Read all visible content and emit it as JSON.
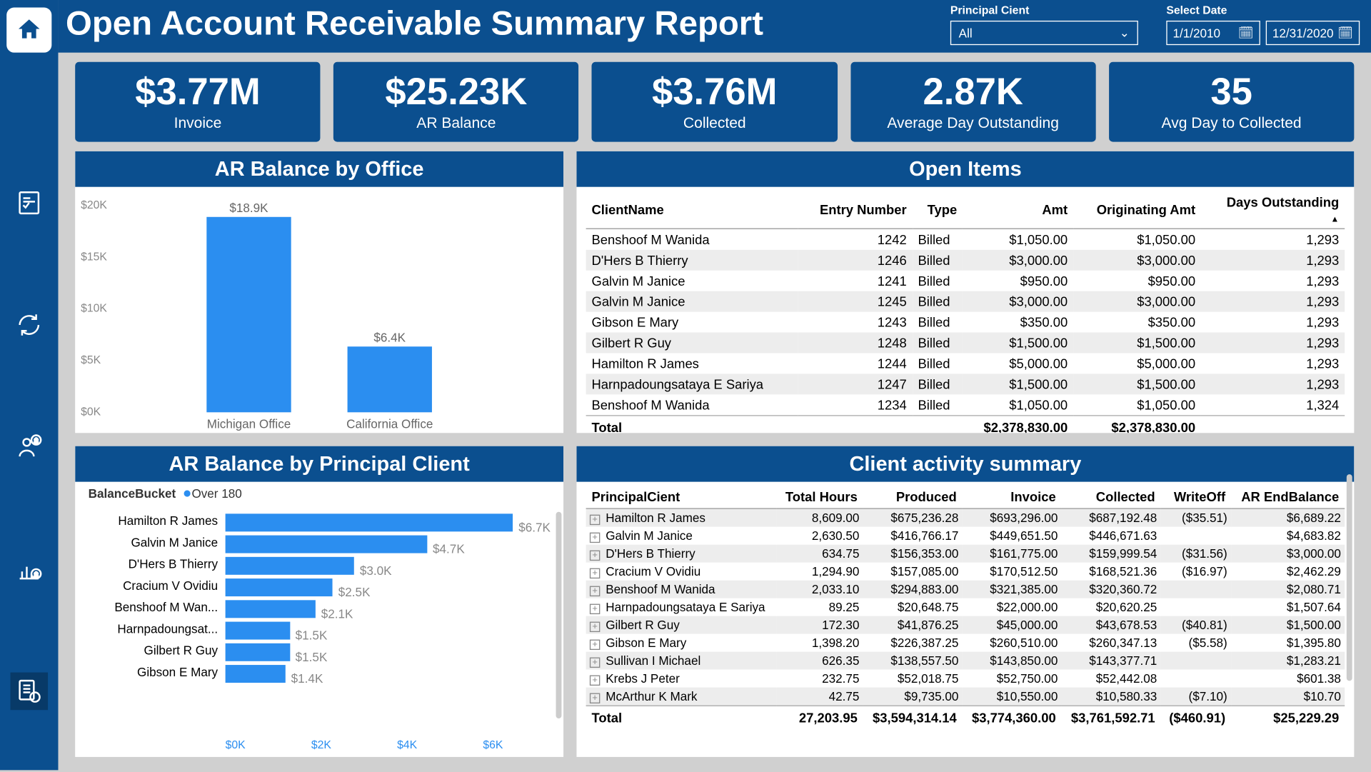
{
  "title": "Open Account Receivable Summary Report",
  "filters": {
    "client_label": "Principal Cient",
    "client_value": "All",
    "date_label": "Select Date",
    "date_start": "1/1/2010",
    "date_end": "12/31/2020"
  },
  "kpis": [
    {
      "value": "$3.77M",
      "label": "Invoice"
    },
    {
      "value": "$25.23K",
      "label": "AR Balance"
    },
    {
      "value": "$3.76M",
      "label": "Collected"
    },
    {
      "value": "2.87K",
      "label": "Average Day Outstanding"
    },
    {
      "value": "35",
      "label": "Avg Day to Collected"
    }
  ],
  "ar_office": {
    "title": "AR Balance by Office"
  },
  "ar_client": {
    "title": "AR Balance by Principal Client",
    "legend_label": "BalanceBucket",
    "legend_series": "Over 180"
  },
  "open_items": {
    "title": "Open Items",
    "headers": [
      "ClientName",
      "Entry Number",
      "Type",
      "Amt",
      "Originating Amt",
      "Days Outstanding"
    ],
    "rows": [
      [
        "Benshoof M Wanida",
        "1242",
        "Billed",
        "$1,050.00",
        "$1,050.00",
        "1,293"
      ],
      [
        "D'Hers B Thierry",
        "1246",
        "Billed",
        "$3,000.00",
        "$3,000.00",
        "1,293"
      ],
      [
        "Galvin M Janice",
        "1241",
        "Billed",
        "$950.00",
        "$950.00",
        "1,293"
      ],
      [
        "Galvin M Janice",
        "1245",
        "Billed",
        "$3,000.00",
        "$3,000.00",
        "1,293"
      ],
      [
        "Gibson E Mary",
        "1243",
        "Billed",
        "$350.00",
        "$350.00",
        "1,293"
      ],
      [
        "Gilbert R Guy",
        "1248",
        "Billed",
        "$1,500.00",
        "$1,500.00",
        "1,293"
      ],
      [
        "Hamilton R James",
        "1244",
        "Billed",
        "$5,000.00",
        "$5,000.00",
        "1,293"
      ],
      [
        "Harnpadoungsataya E Sariya",
        "1247",
        "Billed",
        "$1,500.00",
        "$1,500.00",
        "1,293"
      ],
      [
        "Benshoof M Wanida",
        "1234",
        "Billed",
        "$1,050.00",
        "$1,050.00",
        "1,324"
      ]
    ],
    "total": [
      "Total",
      "",
      "",
      "$2,378,830.00",
      "$2,378,830.00",
      ""
    ]
  },
  "activity": {
    "title": "Client activity summary",
    "headers": [
      "PrincipalCient",
      "Total Hours",
      "Produced",
      "Invoice",
      "Collected",
      "WriteOff",
      "AR EndBalance"
    ],
    "rows": [
      [
        "Hamilton R James",
        "8,609.00",
        "$675,236.28",
        "$693,296.00",
        "$687,192.48",
        "($35.51)",
        "$6,689.22"
      ],
      [
        "Galvin M Janice",
        "2,630.50",
        "$416,766.17",
        "$449,651.50",
        "$446,671.63",
        "",
        "$4,683.82"
      ],
      [
        "D'Hers B Thierry",
        "634.75",
        "$156,353.00",
        "$161,775.00",
        "$159,999.54",
        "($31.56)",
        "$3,000.00"
      ],
      [
        "Cracium V Ovidiu",
        "1,294.90",
        "$157,085.00",
        "$170,512.50",
        "$168,521.36",
        "($16.97)",
        "$2,462.29"
      ],
      [
        "Benshoof M Wanida",
        "2,033.10",
        "$294,883.00",
        "$321,385.00",
        "$320,360.72",
        "",
        "$2,080.71"
      ],
      [
        "Harnpadoungsataya E Sariya",
        "89.25",
        "$20,648.75",
        "$22,000.00",
        "$20,620.25",
        "",
        "$1,507.64"
      ],
      [
        "Gilbert R Guy",
        "172.30",
        "$41,876.25",
        "$45,000.00",
        "$43,678.53",
        "($40.81)",
        "$1,500.00"
      ],
      [
        "Gibson E Mary",
        "1,398.20",
        "$226,387.25",
        "$260,510.00",
        "$260,347.13",
        "($5.58)",
        "$1,395.80"
      ],
      [
        "Sullivan I Michael",
        "626.35",
        "$138,557.50",
        "$143,850.00",
        "$143,377.71",
        "",
        "$1,283.21"
      ],
      [
        "Krebs J Peter",
        "232.75",
        "$52,018.75",
        "$52,750.00",
        "$52,442.08",
        "",
        "$601.38"
      ],
      [
        "McArthur K Mark",
        "42.75",
        "$9,735.00",
        "$10,550.00",
        "$10,580.33",
        "($7.10)",
        "$10.70"
      ]
    ],
    "total": [
      "Total",
      "27,203.95",
      "$3,594,314.14",
      "$3,774,360.00",
      "$3,761,592.71",
      "($460.91)",
      "$25,229.29"
    ]
  },
  "chart_data": [
    {
      "type": "bar",
      "title": "AR Balance by Office",
      "categories": [
        "Michigan Office",
        "California Office"
      ],
      "values": [
        18900,
        6400
      ],
      "value_labels": [
        "$18.9K",
        "$6.4K"
      ],
      "ylabel": "",
      "xlabel": "",
      "yticks": [
        "$0K",
        "$5K",
        "$10K",
        "$15K",
        "$20K"
      ],
      "ylim": [
        0,
        20000
      ]
    },
    {
      "type": "bar",
      "orientation": "horizontal",
      "title": "AR Balance by Principal Client",
      "legend": "BalanceBucket",
      "series": [
        {
          "name": "Over 180",
          "values": [
            6700,
            4700,
            3000,
            2500,
            2100,
            1500,
            1500,
            1400
          ]
        }
      ],
      "categories": [
        "Hamilton R James",
        "Galvin M Janice",
        "D'Hers B Thierry",
        "Cracium V Ovidiu",
        "Benshoof M Wan...",
        "Harnpadoungsat...",
        "Gilbert R Guy",
        "Gibson E Mary"
      ],
      "value_labels": [
        "$6.7K",
        "$4.7K",
        "$3.0K",
        "$2.5K",
        "$2.1K",
        "$1.5K",
        "$1.5K",
        "$1.4K"
      ],
      "xticks": [
        "$0K",
        "$2K",
        "$4K",
        "$6K"
      ],
      "xlim": [
        0,
        7000
      ]
    }
  ]
}
